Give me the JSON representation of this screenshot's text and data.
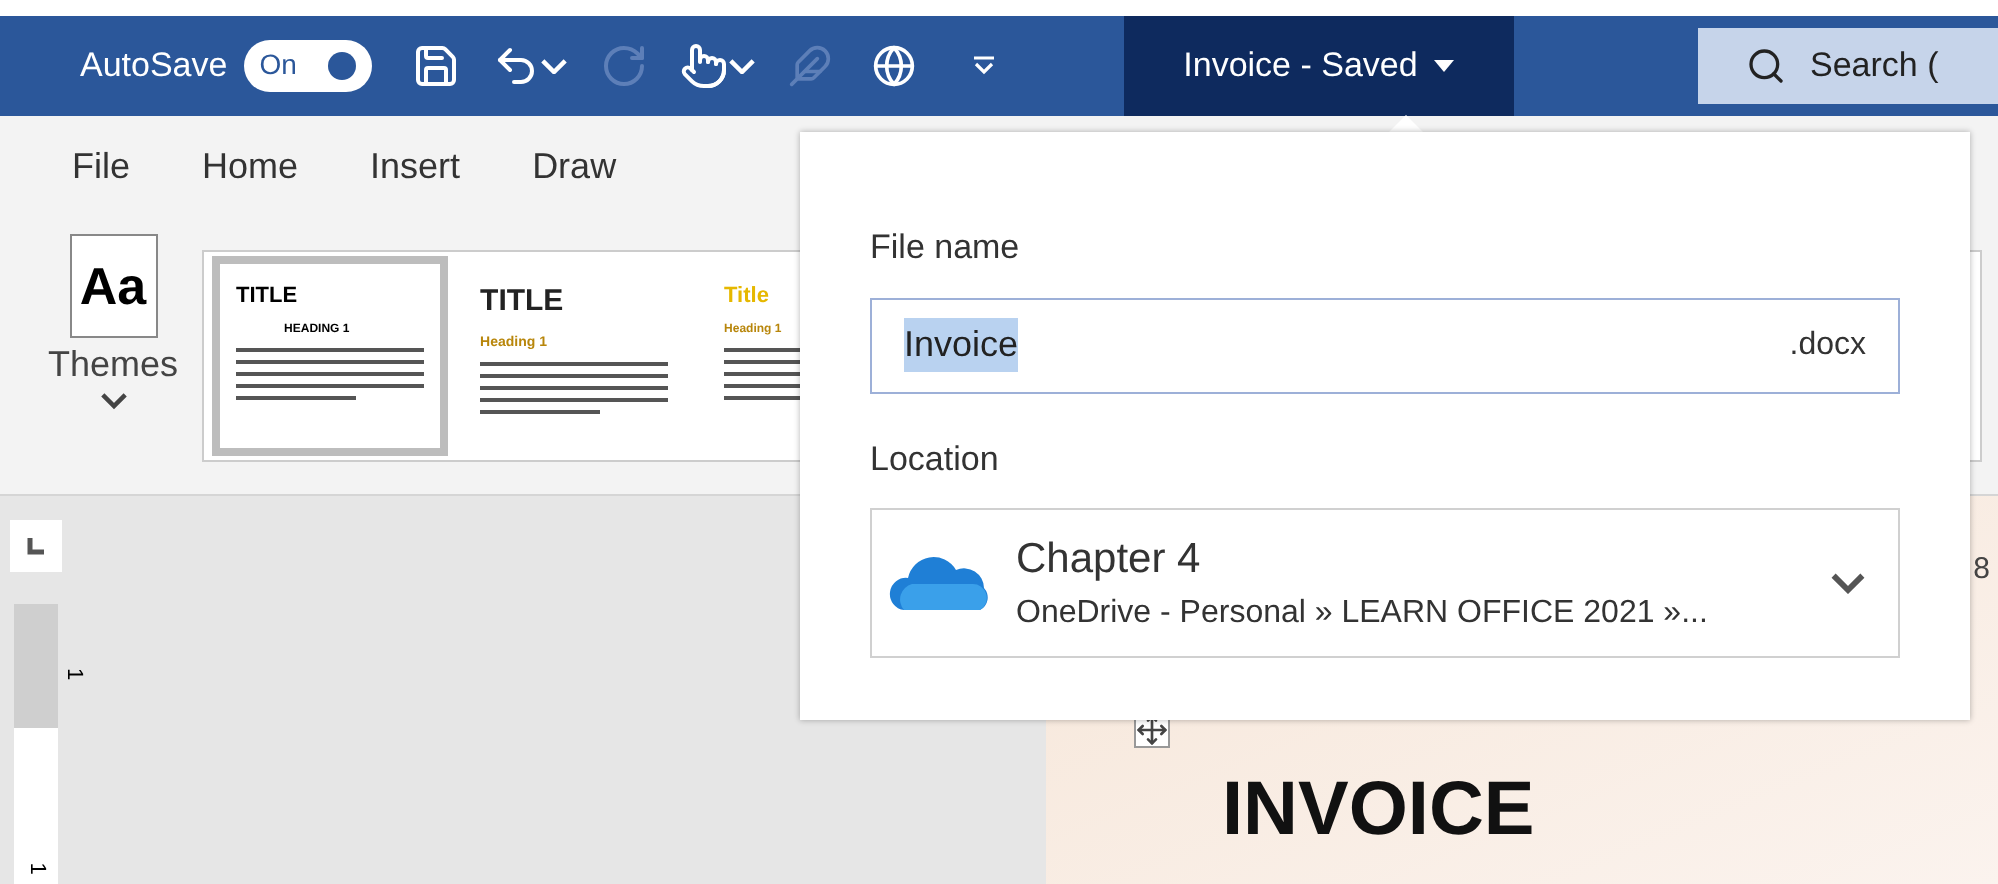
{
  "title_bar": {
    "autosave": {
      "label": "AutoSave",
      "toggle_label": "On",
      "on": true
    },
    "document_title": "Invoice - Saved",
    "search": {
      "placeholder": "Search ("
    }
  },
  "ribbon_tabs": [
    {
      "label": "File",
      "selected": false
    },
    {
      "label": "Home",
      "selected": false
    },
    {
      "label": "Insert",
      "selected": false
    },
    {
      "label": "Draw",
      "selected": false
    }
  ],
  "themes_button": {
    "label": "Themes",
    "icon_text": "Aa"
  },
  "style_gallery": [
    {
      "kind": "plain",
      "title": "TITLE",
      "heading": "HEADING 1",
      "selected": true
    },
    {
      "kind": "bold",
      "title": "TITLE",
      "heading": "Heading 1",
      "selected": false
    },
    {
      "kind": "gold",
      "title": "Title",
      "heading": "Heading 1",
      "selected": false
    }
  ],
  "ruler": {
    "horizontal_label": "8",
    "vertical_labels": [
      "1",
      "1"
    ]
  },
  "document": {
    "heading": "INVOICE"
  },
  "save_popup": {
    "file_name_label": "File name",
    "file_name": "Invoice",
    "extension": ".docx",
    "location_label": "Location",
    "location": {
      "folder": "Chapter 4",
      "path": "OneDrive - Personal » LEARN OFFICE 2021 »..."
    }
  }
}
